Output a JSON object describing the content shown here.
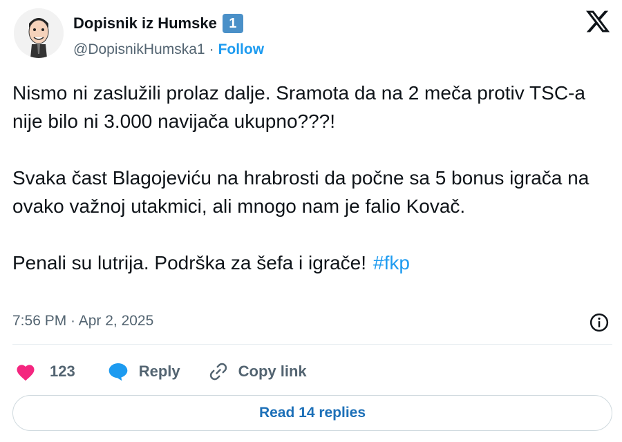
{
  "author": {
    "display_name": "Dopisnik iz Humske",
    "badge": "1",
    "handle": "@DopisnikHumska1",
    "separator": "·",
    "follow_label": "Follow"
  },
  "tweet": {
    "paragraph_1": "Nismo ni zaslužili prolaz dalje. Sramota da na 2 meča protiv TSC-a nije bilo ni 3.000 navijača ukupno???!",
    "paragraph_2": "Svaka čast Blagojeviću na hrabrosti da počne sa 5 bonus igrača na ovako važnoj utakmici, ali mnogo nam je falio Kovač.",
    "paragraph_3": "Penali su lutrija. Podrška za šefa i igrače!",
    "hashtag": "#fkp",
    "timestamp": "7:56 PM · Apr 2, 2025"
  },
  "actions": {
    "like_count": "123",
    "reply_label": "Reply",
    "copy_link_label": "Copy link"
  },
  "read_replies_label": "Read 14 replies",
  "icons": {
    "avatar": "caricature-avatar",
    "platform_logo": "x-logo-icon",
    "info": "info-icon",
    "like": "heart-icon",
    "reply": "speech-bubble-icon",
    "copy_link": "link-icon"
  },
  "colors": {
    "like": "#f4267f",
    "reply": "#1d9bf0",
    "link_accent": "#1d9bf0",
    "badge": "#4a90c8"
  }
}
